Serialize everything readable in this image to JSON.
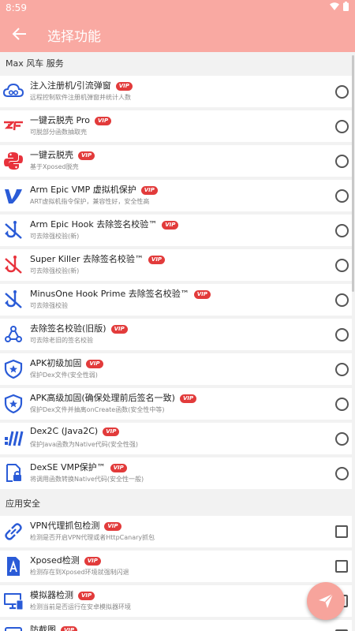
{
  "status": {
    "time": "8:59"
  },
  "appbar": {
    "title": "选择功能"
  },
  "sections": {
    "max": "Max 风车 服务",
    "security": "应用安全"
  },
  "vip_label": "VIP",
  "items": [
    {
      "name": "注入注册机/引流弹窗",
      "desc": "远程控制软件注册机弹窗并统计人数",
      "icon": "cloud-link-icon"
    },
    {
      "name": "一键云脱壳 Pro",
      "desc": "可脱部分函数抽取壳",
      "icon": "zf-logo-icon"
    },
    {
      "name": "一键云脱壳",
      "desc": "基于Xposed脱壳",
      "icon": "python-icon"
    },
    {
      "name": "Arm Epic VMP 虚拟机保护",
      "desc": "ART虚拟机指令保护，兼容性好，安全性高",
      "icon": "v-logo-icon"
    },
    {
      "name": "Arm Epic Hook 去除签名校验™",
      "desc": "可去除强校验(新)",
      "icon": "hook-off-icon"
    },
    {
      "name": "Super Killer 去除签名校验™",
      "desc": "可去除强校验(新)",
      "icon": "hook-off-red-icon"
    },
    {
      "name": "MinusOne Hook Prime 去除签名校验™",
      "desc": "可去除强校验",
      "icon": "hook-off-icon"
    },
    {
      "name": "去除签名校验(旧版)",
      "desc": "可去除老旧的签名校验",
      "icon": "webhook-icon"
    },
    {
      "name": "APK初级加固",
      "desc": "保护Dex文件(安全性弱)",
      "icon": "shield-star-icon"
    },
    {
      "name": "APK高级加固(确保处理前后签名一致)",
      "desc": "保护Dex文件并抽离onCreate函数(安全性中等)",
      "icon": "shield-star-icon"
    },
    {
      "name": "Dex2C (Java2C)",
      "desc": "保护Java函数为Native代码(安全性强)",
      "icon": "dex2c-icon"
    },
    {
      "name": "DexSE VMP保护™",
      "desc": "将调用函数转换Native代码(安全性一般)",
      "icon": "lock-file-icon"
    }
  ],
  "security_items": [
    {
      "name": "VPN代理抓包检测",
      "desc": "检测是否开启VPN代理或者HttpCanary抓包",
      "icon": "link-icon"
    },
    {
      "name": "Xposed检测",
      "desc": "检测存在到Xposed环境就强制闪退",
      "icon": "xposed-icon"
    },
    {
      "name": "模拟器检测",
      "desc": "检测当前是否运行在安卓模拟器环境",
      "icon": "monitor-icon"
    },
    {
      "name": "防截图",
      "desc": "",
      "icon": "screenshot-icon"
    }
  ],
  "colors": {
    "accent": "#f9a9a2",
    "vip": "#e23b3b",
    "icon_blue": "#2a5bd7",
    "icon_red": "#e8323c"
  }
}
